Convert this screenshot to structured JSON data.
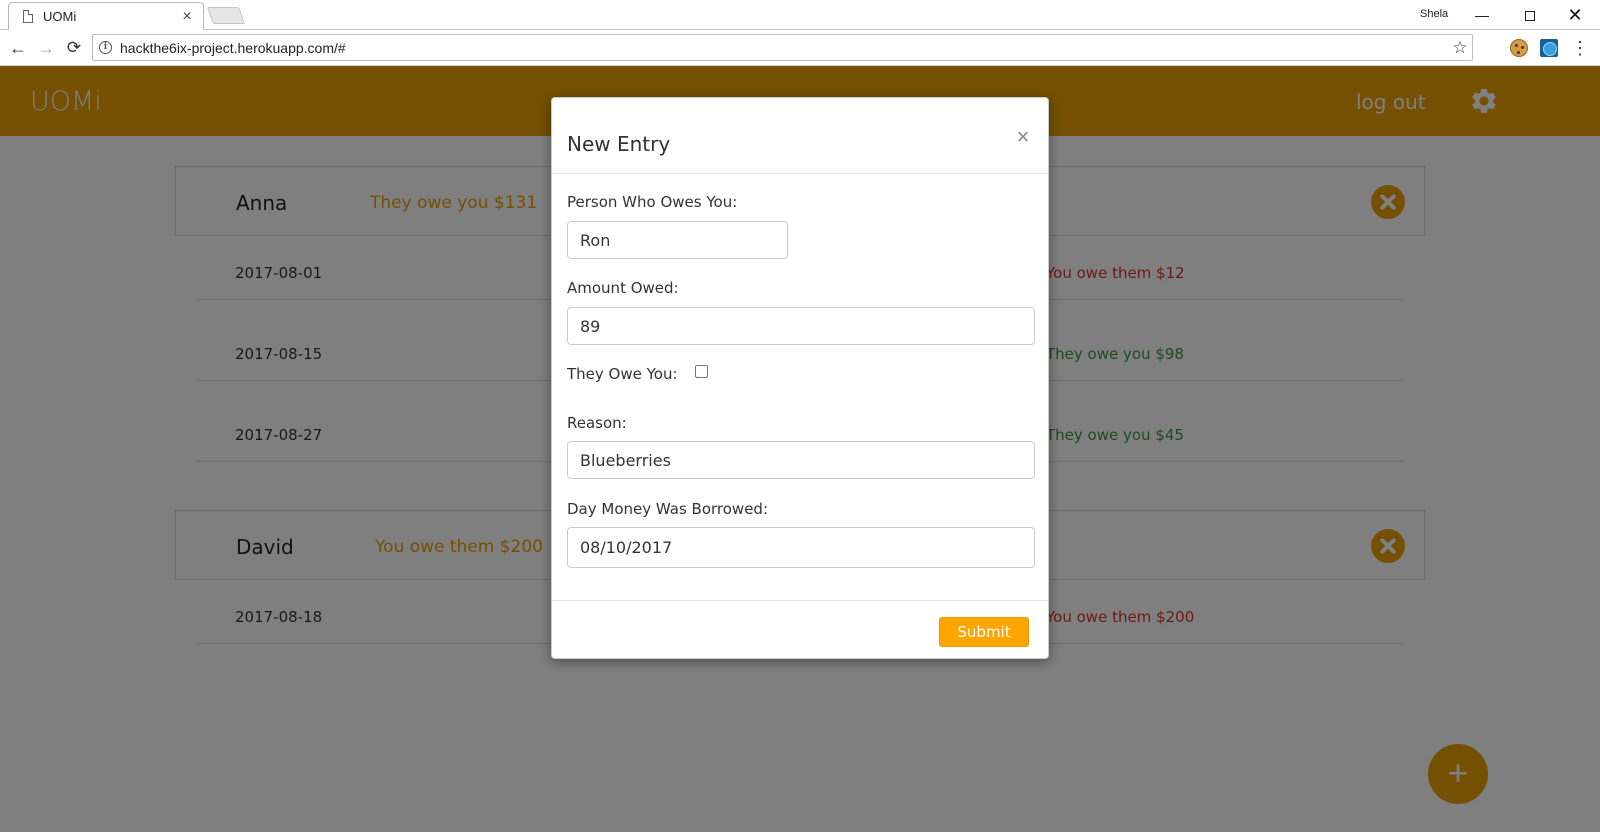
{
  "browser": {
    "tab_title": "UOMi",
    "tab_close": "×",
    "user": "Shela",
    "minimize": "—",
    "close": "✕",
    "url": "hackthe6ix-project.herokuapp.com/#",
    "nav_back": "←",
    "nav_forward": "→",
    "nav_reload": "⟳",
    "star": "☆",
    "menu": "⋮",
    "info": "i"
  },
  "app": {
    "brand": "UOMi",
    "logout": "log out",
    "add_button": "+",
    "accent_color": "#e8a100",
    "owe_you_color": "#3a9a3a",
    "you_owe_color": "#d9342b"
  },
  "people": [
    {
      "name": "Anna",
      "summary": "They owe you $131",
      "entries": [
        {
          "date": "2017-08-01",
          "amount": "You owe them $12",
          "direction": "you_owe"
        },
        {
          "date": "2017-08-15",
          "amount": "They owe you $98",
          "direction": "owe_you"
        },
        {
          "date": "2017-08-27",
          "amount": "They owe you $45",
          "direction": "owe_you"
        }
      ]
    },
    {
      "name": "David",
      "summary": "You owe them $200",
      "entries": [
        {
          "date": "2017-08-18",
          "amount": "You owe them $200",
          "direction": "you_owe"
        }
      ]
    }
  ],
  "modal": {
    "title": "New Entry",
    "close": "×",
    "person_label": "Person Who Owes You:",
    "person_value": "Ron",
    "amount_label": "Amount Owed:",
    "amount_value": "89",
    "they_owe_label": "They Owe You:",
    "they_owe_checked": false,
    "reason_label": "Reason:",
    "reason_value": "Blueberries",
    "date_label": "Day Money Was Borrowed:",
    "date_value": "08/10/2017",
    "submit": "Submit"
  }
}
